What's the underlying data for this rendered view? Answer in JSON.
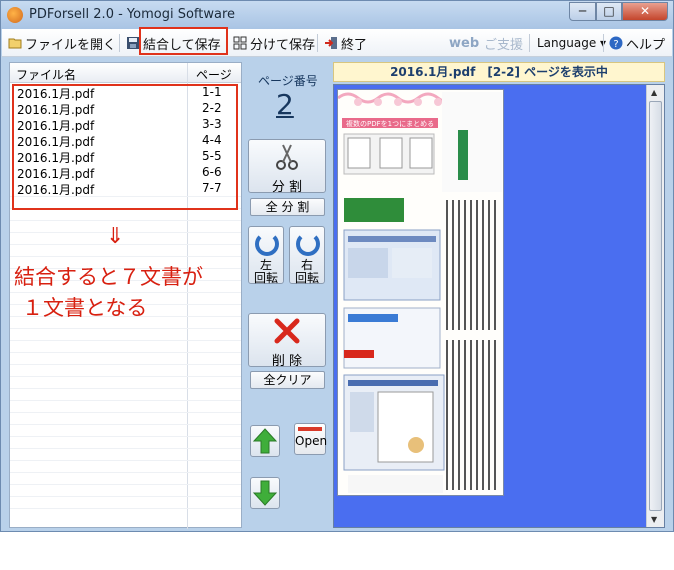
{
  "window": {
    "title": "PDForsell 2.0 - Yomogi Software"
  },
  "titlebar_buttons": {
    "minimize": "─",
    "maximize": "□",
    "close": "✕"
  },
  "toolbar": {
    "open_label": "ファイルを開く",
    "merge_save_label": "結合して保存",
    "split_save_label": "分けて保存",
    "exit_label": "終了",
    "web_label": "web",
    "support_label": "ご支援",
    "language_label": "Language ▾",
    "help_label": "ヘルプ"
  },
  "file_list": {
    "col_name": "ファイル名",
    "col_page": "ページ",
    "rows": [
      {
        "name": "2016.1月.pdf",
        "page": "1-1"
      },
      {
        "name": "2016.1月.pdf",
        "page": "2-2"
      },
      {
        "name": "2016.1月.pdf",
        "page": "3-3"
      },
      {
        "name": "2016.1月.pdf",
        "page": "4-4"
      },
      {
        "name": "2016.1月.pdf",
        "page": "5-5"
      },
      {
        "name": "2016.1月.pdf",
        "page": "6-6"
      },
      {
        "name": "2016.1月.pdf",
        "page": "7-7"
      }
    ]
  },
  "annotation": {
    "arrow": "⇓",
    "line1": "結合すると７文書が",
    "line2": "１文書となる"
  },
  "controls": {
    "page_number_label": "ページ番号",
    "page_number": "2",
    "split_label": "分 割",
    "split_all_label": "全 分 割",
    "rotate_left_label_1": "左",
    "rotate_left_label_2": "回転",
    "rotate_right_label_1": "右",
    "rotate_right_label_2": "回転",
    "delete_label": "削 除",
    "clear_all_label": "全クリア",
    "open_label": "Open"
  },
  "preview": {
    "header": "2016.1月.pdf　[2-2] ページを表示中",
    "doc_heading": "複数のPDFを1つにまとめる",
    "doc_side_title": "結合・分割・挿入まで作ったPDFを自由に加工"
  },
  "colors": {
    "accent_red": "#e0321b",
    "annotation_red": "#d82010",
    "preview_blue": "#4a6ef0"
  }
}
